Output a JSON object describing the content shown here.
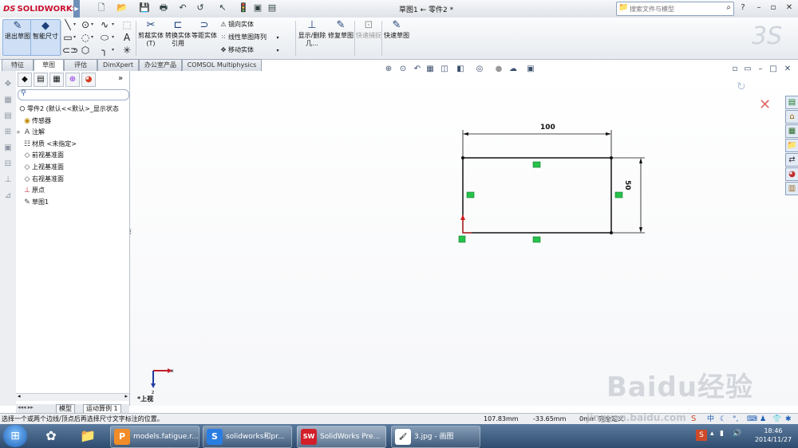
{
  "app": {
    "logo_text": "SOLIDWORKS",
    "logo_ds": "DS",
    "title": "草图1 ← 零件2 *",
    "search_placeholder": "搜索文件与模型"
  },
  "quick_access": [
    "new-icon",
    "open-icon",
    "save-icon",
    "print-icon",
    "undo-icon",
    "select-icon",
    "rebuild-icon",
    "options-icon"
  ],
  "command_manager": {
    "exit_sketch": "退出草图",
    "smart_dimension": "智能尺寸",
    "trim": "剪裁实体(T)",
    "convert": "转换实体引用",
    "offset": "等距实体",
    "mirror": "镜向实体",
    "linear_pattern": "线性草图阵列",
    "move": "移动实体",
    "display_delete": "显示/删除几...",
    "repair": "修复草图",
    "quick_snaps": "快速捕捉",
    "rapid_sketch": "快速草图"
  },
  "tabs": [
    "特征",
    "草图",
    "评估",
    "DimXpert",
    "办公室产品",
    "COMSOL Multiphysics"
  ],
  "active_tab": 1,
  "feature_tree": [
    {
      "label": "零件2 (默认<<默认>_显示状态",
      "icon": "part-icon",
      "level": 0
    },
    {
      "label": "传感器",
      "icon": "sensor-icon",
      "level": 1
    },
    {
      "label": "注解",
      "icon": "annotation-icon",
      "level": 1
    },
    {
      "label": "材质 <未指定>",
      "icon": "material-icon",
      "level": 1
    },
    {
      "label": "前视基准面",
      "icon": "plane-icon",
      "level": 1
    },
    {
      "label": "上视基准面",
      "icon": "plane-icon",
      "level": 1
    },
    {
      "label": "右视基准面",
      "icon": "plane-icon",
      "level": 1
    },
    {
      "label": "原点",
      "icon": "origin-icon",
      "level": 1
    },
    {
      "label": "草图1",
      "icon": "sketch-icon",
      "level": 1
    }
  ],
  "sketch": {
    "dim_width": "100",
    "dim_height": "50",
    "view_label": "*上视"
  },
  "bottom_tabs": [
    "模型",
    "运动算例 1"
  ],
  "status": {
    "message": "选择一个或两个边线/顶点后再选择尺寸文字标注的位置。",
    "x": "107.83mm",
    "y": "-33.65mm",
    "z": "0mm",
    "state": "完全定义"
  },
  "taskbar": {
    "items": [
      {
        "label": "models.fatigue.r...",
        "icon": "pdf-icon"
      },
      {
        "label": "solidworks和pr...",
        "icon": "browser-icon"
      },
      {
        "label": "SolidWorks Pre...",
        "icon": "solidworks-icon"
      },
      {
        "label": "3.jpg - 画图",
        "icon": "paint-icon"
      }
    ],
    "time": "18:46",
    "date": "2014/11/27"
  },
  "watermark": "Baidu经验",
  "watermark_url": "jingyan.baidu.com",
  "colors": {
    "accent": "#1d5db5",
    "relation_green": "#27c24c",
    "origin_red": "#d22020"
  }
}
